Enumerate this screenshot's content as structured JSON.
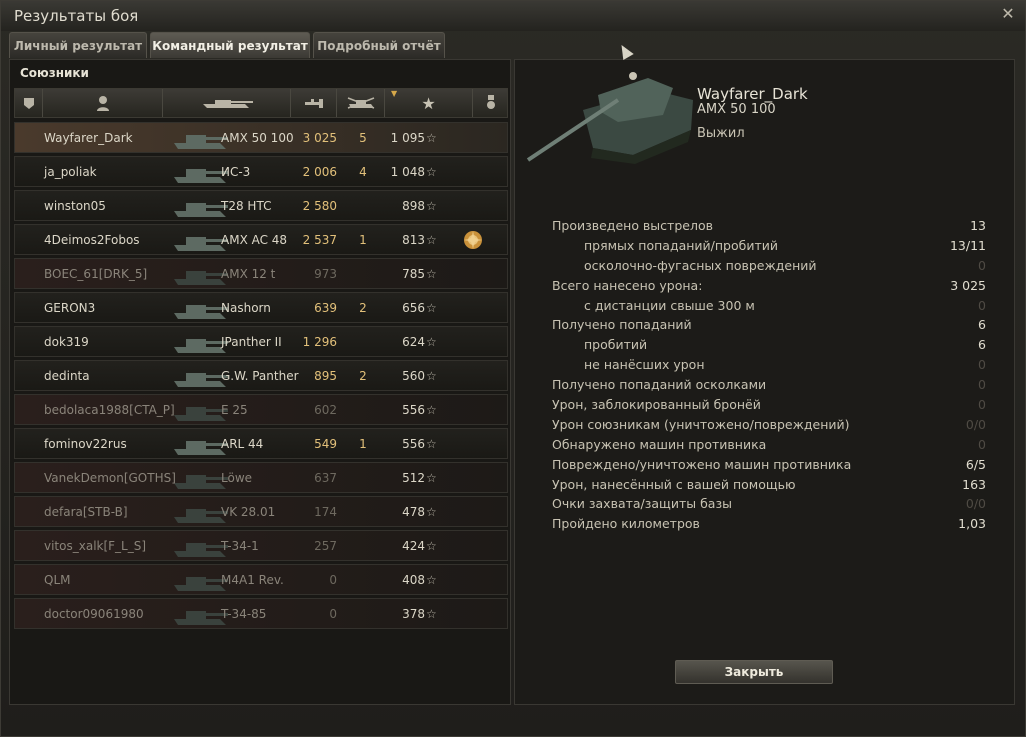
{
  "window": {
    "title": "Результаты боя"
  },
  "tabs": [
    {
      "label": "Личный результат"
    },
    {
      "label": "Командный результат"
    },
    {
      "label": "Подробный отчёт"
    }
  ],
  "team": {
    "title": "Союзники",
    "columns": [
      "rank-icon",
      "player-icon",
      "tank-icon",
      "damage-icon",
      "kills-icon",
      "xp-sort-star-icon",
      "medal-icon"
    ],
    "rows": [
      {
        "name": "Wayfarer_Dark",
        "tank": "AMX 50 100",
        "damage": "3 025",
        "kills": "5",
        "xp": "1 095",
        "alive": true,
        "me": true,
        "medal": false
      },
      {
        "name": "ja_poliak",
        "tank": "ИС-3",
        "damage": "2 006",
        "kills": "4",
        "xp": "1 048",
        "alive": true,
        "me": false,
        "medal": false
      },
      {
        "name": "winston05",
        "tank": "T28 HTC",
        "damage": "2 580",
        "kills": "",
        "xp": "898",
        "alive": true,
        "me": false,
        "medal": false
      },
      {
        "name": "4Deimos2Fobos",
        "tank": "AMX AC 48",
        "damage": "2 537",
        "kills": "1",
        "xp": "813",
        "alive": true,
        "me": false,
        "medal": true
      },
      {
        "name": "BOEC_61[DRK_5]",
        "tank": "AMX 12 t",
        "damage": "973",
        "kills": "",
        "xp": "785",
        "alive": false,
        "me": false,
        "medal": false
      },
      {
        "name": "GERON3",
        "tank": "Nashorn",
        "damage": "639",
        "kills": "2",
        "xp": "656",
        "alive": true,
        "me": false,
        "medal": false
      },
      {
        "name": "dok319",
        "tank": "JPanther II",
        "damage": "1 296",
        "kills": "",
        "xp": "624",
        "alive": true,
        "me": false,
        "medal": false
      },
      {
        "name": "dedinta",
        "tank": "G.W. Panther",
        "damage": "895",
        "kills": "2",
        "xp": "560",
        "alive": true,
        "me": false,
        "medal": false
      },
      {
        "name": "bedolaca1988[CTA_P]",
        "tank": "E 25",
        "damage": "602",
        "kills": "",
        "xp": "556",
        "alive": false,
        "me": false,
        "medal": false
      },
      {
        "name": "fominov22rus",
        "tank": "ARL 44",
        "damage": "549",
        "kills": "1",
        "xp": "556",
        "alive": true,
        "me": false,
        "medal": false
      },
      {
        "name": "VanekDemon[GOTHS]",
        "tank": "Löwe",
        "damage": "637",
        "kills": "",
        "xp": "512",
        "alive": false,
        "me": false,
        "medal": false
      },
      {
        "name": "defara[STB-B]",
        "tank": "VK 28.01",
        "damage": "174",
        "kills": "",
        "xp": "478",
        "alive": false,
        "me": false,
        "medal": false
      },
      {
        "name": "vitos_xalk[F_L_S]",
        "tank": "T-34-1",
        "damage": "257",
        "kills": "",
        "xp": "424",
        "alive": false,
        "me": false,
        "medal": false
      },
      {
        "name": "QLM",
        "tank": "M4A1 Rev.",
        "damage": "0",
        "kills": "",
        "xp": "408",
        "alive": false,
        "me": false,
        "medal": false
      },
      {
        "name": "doctor09061980",
        "tank": "T-34-85",
        "damage": "0",
        "kills": "",
        "xp": "378",
        "alive": false,
        "me": false,
        "medal": false
      }
    ],
    "star": "☆"
  },
  "detail": {
    "player": "Wayfarer_Dark",
    "tank": "AMX 50 100",
    "status": "Выжил",
    "stats": [
      {
        "label": "Произведено выстрелов",
        "value": "13",
        "indent": false,
        "zero": false
      },
      {
        "label": "прямых попаданий/пробитий",
        "value": "13/11",
        "indent": true,
        "zero": false
      },
      {
        "label": "осколочно-фугасных повреждений",
        "value": "0",
        "indent": true,
        "zero": true
      },
      {
        "label": "Всего нанесено урона:",
        "value": "3 025",
        "indent": false,
        "zero": false
      },
      {
        "label": "с дистанции свыше 300 м",
        "value": "0",
        "indent": true,
        "zero": true
      },
      {
        "label": "Получено попаданий",
        "value": "6",
        "indent": false,
        "zero": false
      },
      {
        "label": "пробитий",
        "value": "6",
        "indent": true,
        "zero": false
      },
      {
        "label": "не нанёсших урон",
        "value": "0",
        "indent": true,
        "zero": true
      },
      {
        "label": "Получено попаданий осколками",
        "value": "0",
        "indent": false,
        "zero": true
      },
      {
        "label": "Урон, заблокированный бронёй",
        "value": "0",
        "indent": false,
        "zero": true
      },
      {
        "label": "Урон союзникам (уничтожено/повреждений)",
        "value": "0/0",
        "indent": false,
        "zero": true
      },
      {
        "label": "Обнаружено машин противника",
        "value": "0",
        "indent": false,
        "zero": true
      },
      {
        "label": "Повреждено/уничтожено машин противника",
        "value": "6/5",
        "indent": false,
        "zero": false
      },
      {
        "label": "Урон, нанесённый с вашей помощью",
        "value": "163",
        "indent": false,
        "zero": false
      },
      {
        "label": "Очки захвата/защиты базы",
        "value": "0/0",
        "indent": false,
        "zero": true
      },
      {
        "label": "Пройдено километров",
        "value": "1,03",
        "indent": false,
        "zero": false
      }
    ],
    "close_button": "Закрыть"
  }
}
